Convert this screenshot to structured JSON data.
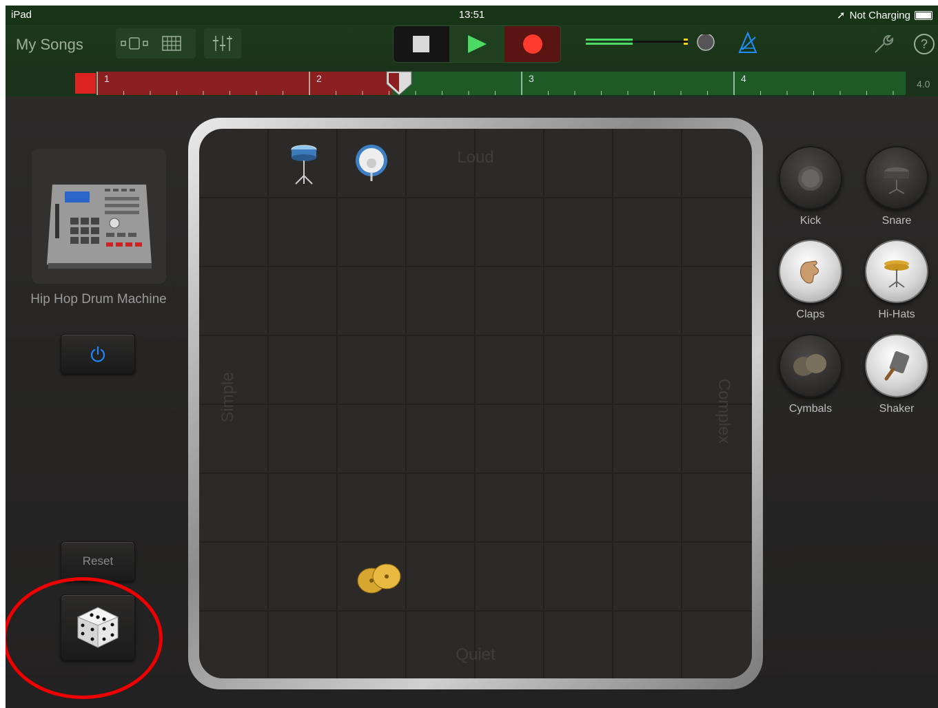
{
  "status": {
    "device": "iPad",
    "time": "13:51",
    "battery_text": "Not Charging"
  },
  "toolbar": {
    "my_songs": "My Songs"
  },
  "ruler": {
    "bars": [
      "1",
      "2",
      "3",
      "4"
    ],
    "end_label": "4.0"
  },
  "instrument": {
    "name": "Hip Hop Drum Machine"
  },
  "buttons": {
    "reset": "Reset"
  },
  "pad": {
    "top": "Loud",
    "bottom": "Quiet",
    "left": "Simple",
    "right": "Complex"
  },
  "drums": [
    {
      "label": "Kick",
      "state": "off"
    },
    {
      "label": "Snare",
      "state": "off"
    },
    {
      "label": "Claps",
      "state": "on"
    },
    {
      "label": "Hi-Hats",
      "state": "on"
    },
    {
      "label": "Cymbals",
      "state": "off"
    },
    {
      "label": "Shaker",
      "state": "on"
    }
  ],
  "colors": {
    "toolbar": "#1d3a1c",
    "record": "#ff3b30",
    "play": "#4cd964",
    "power": "#1e88ff",
    "annotation": "#e00000"
  }
}
